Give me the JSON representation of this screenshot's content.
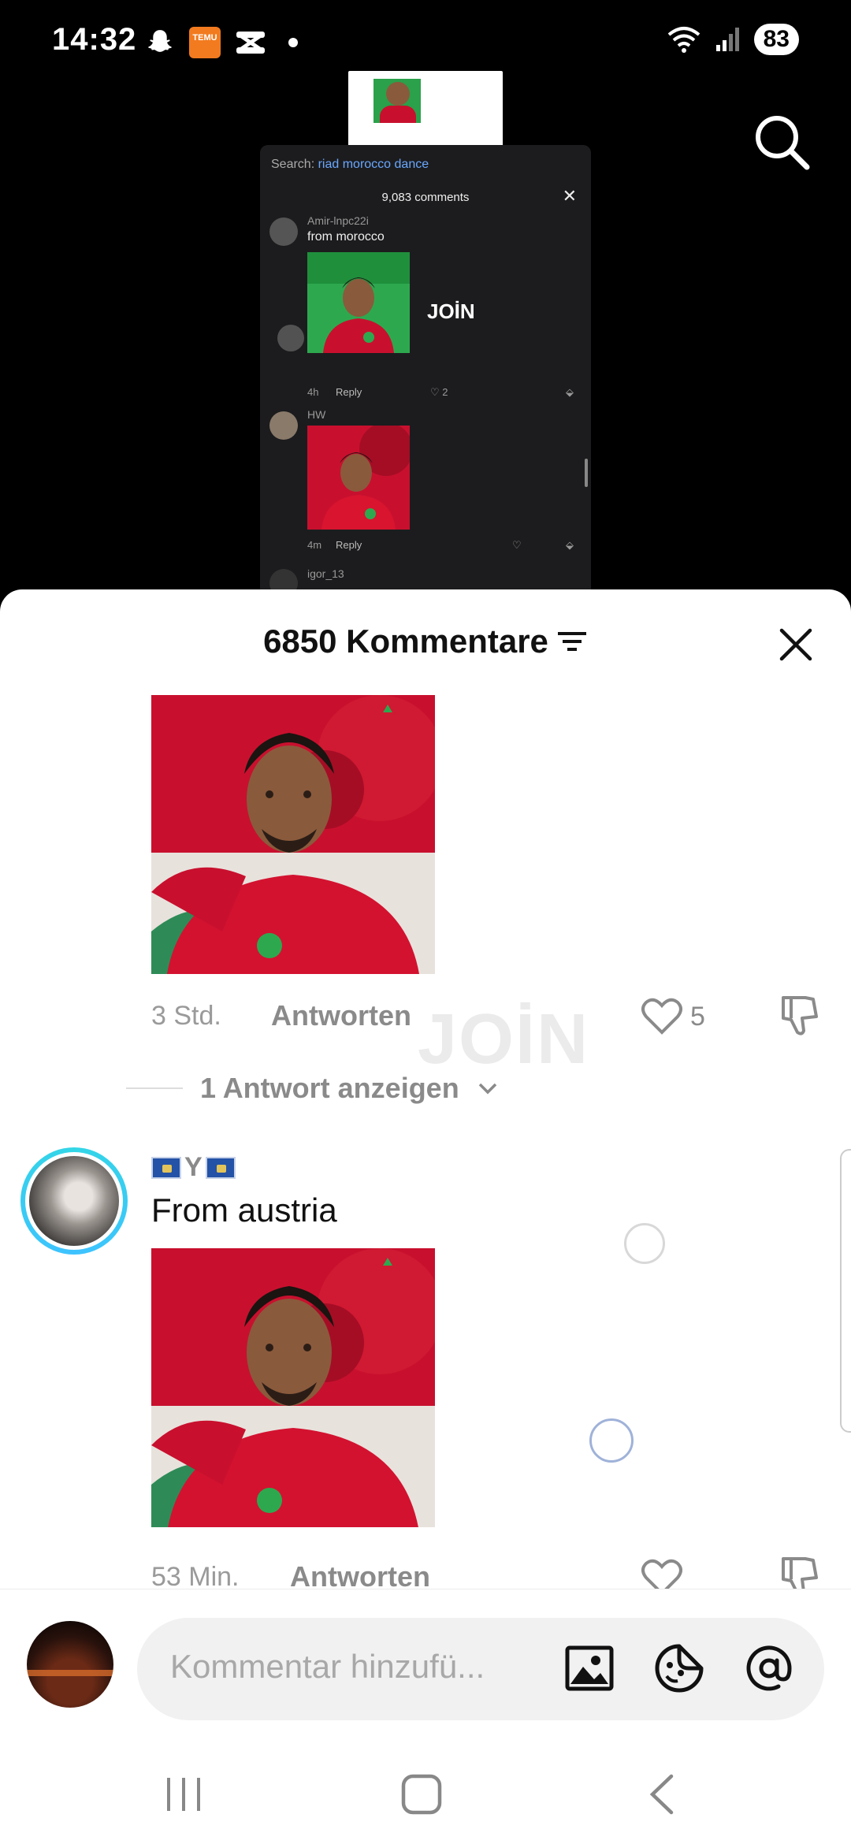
{
  "status_bar": {
    "time": "14:32",
    "temu_label": "TEMU",
    "battery": "83",
    "icons": [
      "snapchat-icon",
      "temu-icon",
      "capcut-icon",
      "dot-icon",
      "wifi-icon",
      "signal-icon",
      "battery-icon"
    ]
  },
  "background": {
    "search_icon": "search-icon",
    "preview": {
      "search_prefix": "Search:",
      "search_query": "riad morocco dance",
      "comments_count": "9,083 comments",
      "comment1_user": "Amir-lnpc22i",
      "comment1_text": "from morocco",
      "comment1_time": "4h",
      "comment1_reply": "Reply",
      "comment1_likes": "2",
      "overlay_join": "JOİN",
      "comment2_user": "HW",
      "comment2_time": "4m",
      "comment2_reply": "Reply",
      "comment3_user": "igor_13"
    }
  },
  "sheet": {
    "title": "6850 Kommentare",
    "close_icon": "close-icon",
    "sort_icon": "filter-icon",
    "comment1": {
      "time": "3 Std.",
      "reply": "Antworten",
      "likes": "5"
    },
    "show_replies": "1 Antwort anzeigen",
    "watermark": "JOİN",
    "comment2": {
      "username": "Y",
      "text": "From austria",
      "time": "53 Min.",
      "reply": "Antworten"
    }
  },
  "input_bar": {
    "placeholder": "Kommentar hinzufü...",
    "icons": [
      "image-icon",
      "sticker-icon",
      "mention-icon"
    ]
  },
  "system_nav": {
    "icons": [
      "recents-icon",
      "home-icon",
      "back-icon"
    ]
  },
  "colors": {
    "accent_ring": "#33d6e6",
    "temu": "#f27b1f",
    "shirt_red": "#c8102e"
  }
}
